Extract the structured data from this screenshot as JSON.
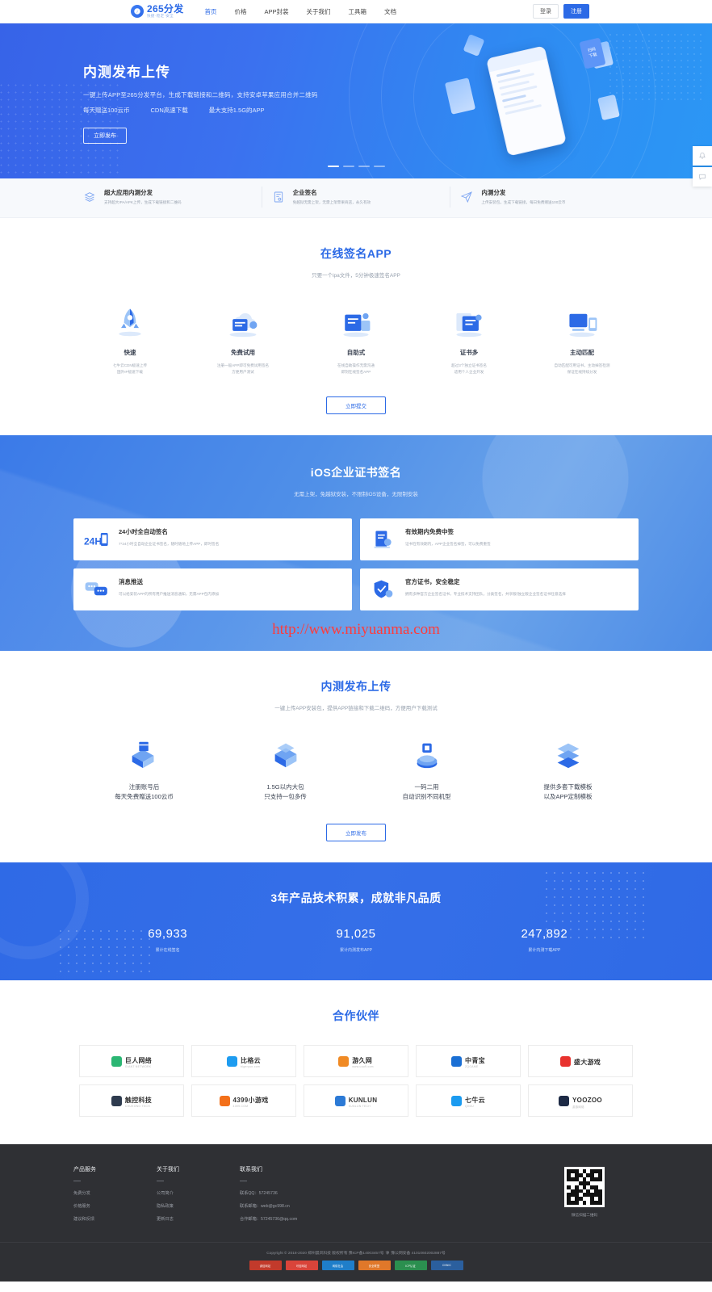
{
  "brand": {
    "name": "265分发",
    "tagline": "快捷·稳定·安全",
    "mark": "2"
  },
  "header": {
    "nav": [
      {
        "label": "首页",
        "active": true
      },
      {
        "label": "价格",
        "active": false
      },
      {
        "label": "APP封装",
        "active": false
      },
      {
        "label": "关于我们",
        "active": false
      },
      {
        "label": "工具箱",
        "active": false
      },
      {
        "label": "文档",
        "active": false
      }
    ],
    "login_label": "登录",
    "register_label": "注册",
    "accent": "#2c6ae6"
  },
  "hero": {
    "title": "内测发布上传",
    "desc": "一键上传APP至265分发平台，生成下载链接和二维码，支持安卓苹果应用合并二维码",
    "highlights": [
      "每天赠送100云币",
      "CDN高速下载",
      "最大支持1.5G的APP"
    ],
    "button": "立即发布",
    "art_tag_line1": "扫码",
    "art_tag_line2": "下载"
  },
  "featurebar": [
    {
      "icon": "layers-icon",
      "title": "超大应用内测分发",
      "desc": "支持超大IPA/APK上传，生成下载链接和二维码"
    },
    {
      "icon": "certificate-icon",
      "title": "企业签名",
      "desc": "免越狱无需上架，无需上架苹果商店，永久有效"
    },
    {
      "icon": "send-icon",
      "title": "内测分发",
      "desc": "上传安装包，生成下载链接，每日免费赠送100云币"
    }
  ],
  "sign_section": {
    "title": "在线签名APP",
    "subtitle": "只要一个ipa文件，5分钟极速签名APP",
    "items": [
      {
        "icon": "rocket-icon",
        "title": "快速",
        "desc": "七牛云CDN极速上传\n国外IP极速下载"
      },
      {
        "icon": "cloud-free-icon",
        "title": "免费试用",
        "desc": "注册一般APP即可免费试用签名\n方便用户测试"
      },
      {
        "icon": "self-service-icon",
        "title": "自助式",
        "desc": "在线自助操作无需沟通\n即刻在线签名APP"
      },
      {
        "icon": "cert-many-icon",
        "title": "证书多",
        "desc": "超过3个独立证书签名\n适用个人企业开发"
      },
      {
        "icon": "auto-match-icon",
        "title": "主动匹配",
        "desc": "自动匹配可用证书，主动掉签检测\n保证在线持续分发"
      }
    ],
    "button": "立即提交"
  },
  "ios_section": {
    "title": "iOS企业证书签名",
    "subtitle": "无需上架，免越狱安装，不限制iOS设备，无限制安装",
    "cards": [
      {
        "icon": "24h-icon",
        "title": "24小时全自动签名",
        "desc": "7*24小时全自动企业证书签名，随时随地上传APP，即时签名"
      },
      {
        "icon": "free-resign-icon",
        "title": "有效期内免费中签",
        "desc": "证书在有效期内，APP企业签名掉签，可以免费重签"
      },
      {
        "icon": "message-push-icon",
        "title": "消息推送",
        "desc": "可以给安装APP的所有用户推送消息通知，无需APP包内添加"
      },
      {
        "icon": "official-cert-icon",
        "title": "官方证书，安全稳定",
        "desc": "拥有多种官方企业签名证书，专业技术支持团队，分类签名，共享版/独立版企业签名证书任意选择"
      }
    ],
    "watermark": "http://www.miyuanma.com"
  },
  "beta_section": {
    "title": "内测发布上传",
    "subtitle": "一键上传APP安装包，提供APP链接和下载二维码，方便用户下载测试",
    "items": [
      {
        "icon": "register-gift-icon",
        "title": "注册账号后\n每天免费赠送100云币"
      },
      {
        "icon": "package-icon",
        "title": "1.5G以内大包\n只支持一包多传"
      },
      {
        "icon": "one-code-icon",
        "title": "一码二用\n自动识别不同机型"
      },
      {
        "icon": "templates-icon",
        "title": "提供多套下载模板\n以及APP定制模板"
      }
    ],
    "button": "立即发布"
  },
  "stats_section": {
    "title": "3年产品技术积累，成就非凡品质",
    "stats": [
      {
        "number": "69,933",
        "label": "累计在线签名"
      },
      {
        "number": "91,025",
        "label": "累计内测发布APP"
      },
      {
        "number": "247,892",
        "label": "累计内测下载APP"
      }
    ]
  },
  "partners_section": {
    "title": "合作伙伴",
    "logos": [
      {
        "name": "巨人网络",
        "sub": "GIANT NETWORK",
        "color": "#2bb673"
      },
      {
        "name": "比格云",
        "sub": "bigeryun.com",
        "color": "#1e9cf0"
      },
      {
        "name": "游久网",
        "sub": "www.uuu9.com",
        "color": "#f08a24"
      },
      {
        "name": "中青宝",
        "sub": "ZQGAME",
        "color": "#1a6fd4"
      },
      {
        "name": "盛大游戏",
        "sub": "",
        "color": "#e8322e"
      },
      {
        "name": "触控科技",
        "sub": "CHUKONG TECH",
        "color": "#2e3b4e"
      },
      {
        "name": "4399小游戏",
        "sub": "4399.COM",
        "color": "#f3701a"
      },
      {
        "name": "KUNLUN",
        "sub": "KUNLUN TECH",
        "color": "#2c7ad6"
      },
      {
        "name": "七牛云",
        "sub": "QINIU",
        "color": "#1b9bf0"
      },
      {
        "name": "YOOZOO",
        "sub": "游族网络",
        "color": "#1d2a45"
      }
    ]
  },
  "footer": {
    "columns": [
      {
        "title": "产品服务",
        "links": [
          "免费分发",
          "价格服务",
          "建议和反馈"
        ]
      },
      {
        "title": "关于我们",
        "links": [
          "公司简介",
          "隐私政策",
          "更新日志"
        ]
      }
    ],
    "contact": {
      "title": "联系我们",
      "lines": [
        "联系QQ：57245736",
        "联系邮箱：web@gc998.cn",
        "合作邮箱：57245736@qq.com"
      ]
    },
    "qr_caption": "微信扫描二维码",
    "copyright": "Copyright © 2018-2020 郑州晨风科技 版权所有 豫ICP备14003457号",
    "icp": "豫公网安备 41010602002887号",
    "badges": [
      "诚信网站",
      "可信网站",
      "网络社会",
      "安全联盟",
      "ICP认证",
      "CNNIC"
    ]
  },
  "floaters": [
    {
      "icon": "bell-icon"
    },
    {
      "icon": "chat-icon"
    }
  ]
}
